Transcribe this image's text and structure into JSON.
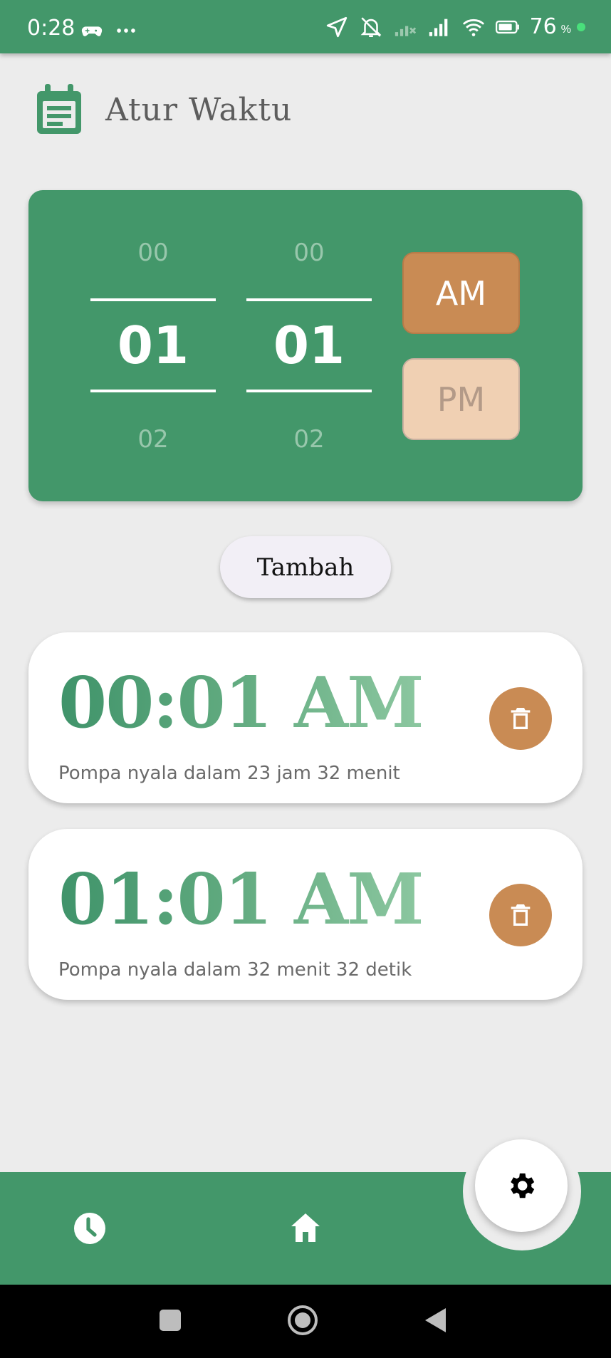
{
  "status_bar": {
    "time": "0:28",
    "battery_percent": "76",
    "battery_symbol": "%",
    "left_icons": [
      "game-controller-icon",
      "more-dots-icon"
    ],
    "right_icons": [
      "location-arrow-icon",
      "bell-off-icon",
      "no-signal-icon",
      "signal-icon",
      "wifi-icon",
      "battery-icon"
    ]
  },
  "header": {
    "title": "Atur Waktu",
    "icon": "calendar-icon"
  },
  "time_picker": {
    "hour": {
      "prev": "00",
      "current": "01",
      "next": "02"
    },
    "minute": {
      "prev": "00",
      "current": "01",
      "next": "02"
    },
    "am_label": "AM",
    "pm_label": "PM",
    "selected": "AM"
  },
  "add_button": {
    "label": "Tambah"
  },
  "alarms": [
    {
      "time": "00:01 AM",
      "countdown": "Pompa nyala dalam 23 jam 32 menit"
    },
    {
      "time": "01:01 AM",
      "countdown": "Pompa nyala dalam 32 menit 32 detik"
    }
  ],
  "bottom_nav": {
    "items": [
      "clock-icon",
      "home-icon"
    ],
    "fab_icon": "gear-icon"
  },
  "colors": {
    "primary_green": "#43976a",
    "accent_orange": "#c98b54",
    "pm_light": "#f0d0b3",
    "background": "#ececec"
  }
}
